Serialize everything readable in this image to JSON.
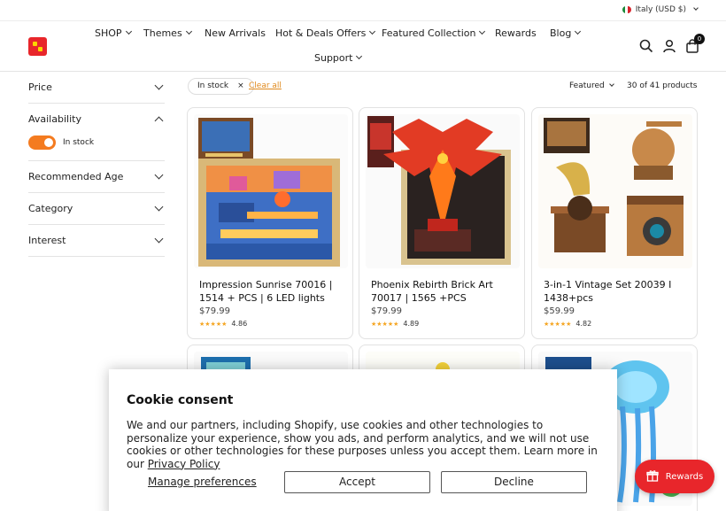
{
  "topbar": {
    "country": "Italy (USD $)"
  },
  "nav": {
    "row1": [
      {
        "label": "SHOP",
        "dropdown": true
      },
      {
        "label": "Themes",
        "dropdown": true
      },
      {
        "label": "New Arrivals",
        "dropdown": false
      },
      {
        "label": "Hot & Deals Offers",
        "dropdown": true
      },
      {
        "label": "Featured Collection",
        "dropdown": true
      },
      {
        "label": "Rewards",
        "dropdown": false
      },
      {
        "label": "Blog",
        "dropdown": true
      }
    ],
    "row2": [
      {
        "label": "Support",
        "dropdown": true
      }
    ]
  },
  "header": {
    "cart_count": "0",
    "icons": [
      "search-icon",
      "account-icon",
      "cart-icon"
    ]
  },
  "filters": {
    "price": "Price",
    "availability": "Availability",
    "in_stock": "In stock",
    "age": "Recommended Age",
    "category": "Category",
    "interest": "Interest"
  },
  "toolbar": {
    "active_filter": "In stock",
    "clear_all": "Clear all",
    "sort": "Featured",
    "count": "30 of 41 products"
  },
  "products": [
    {
      "title": "Impression Sunrise 70016 | 1514 + PCS | 6 LED lights",
      "price": "$79.99",
      "rating": "4.86"
    },
    {
      "title": "Phoenix Rebirth Brick Art 70017 | 1565 +PCS",
      "price": "$79.99",
      "rating": "4.89"
    },
    {
      "title": "3-in-1 Vintage Set 20039 I 1438+pcs",
      "price": "$59.99",
      "rating": "4.82"
    }
  ],
  "cookie": {
    "title": "Cookie consent",
    "text": "We and our partners, including Shopify, use cookies and other technologies to personalize your experience, show you ads, and perform analytics, and we will not use cookies or other technologies for these purposes unless you accept them. Learn more in our",
    "privacy_link": "Privacy Policy",
    "manage": "Manage preferences",
    "accept": "Accept",
    "decline": "Decline"
  },
  "rewards_button": "Rewards",
  "colors": {
    "accent": "#f47b20",
    "brand_red": "#e8262b",
    "link_orange": "#e08a1e"
  }
}
